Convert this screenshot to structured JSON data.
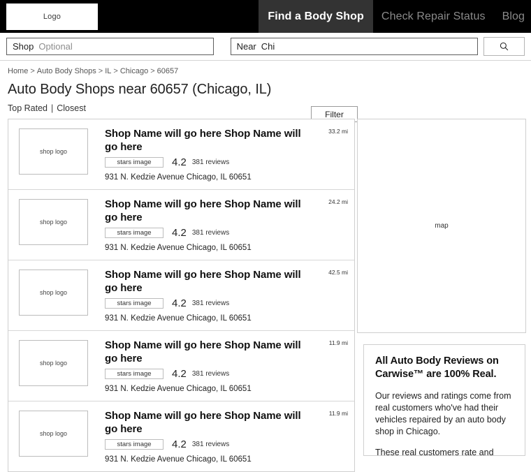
{
  "header": {
    "logo_label": "Logo",
    "nav_items": [
      {
        "label": "Find a Body Shop",
        "active": true
      },
      {
        "label": "Check Repair Status",
        "active": false
      },
      {
        "label": "Blog",
        "active": false
      }
    ]
  },
  "search": {
    "shop_label": "Shop",
    "shop_placeholder": "Optional",
    "shop_value": "",
    "near_label": "Near",
    "near_value": "Chi",
    "near_placeholder": "",
    "search_icon": "search-icon"
  },
  "breadcrumb": {
    "separator": ">",
    "items": [
      "Home",
      "Auto Body Shops",
      "IL",
      "Chicago",
      "60657"
    ]
  },
  "page": {
    "title": "Auto Body Shops near 60657 (Chicago, IL)",
    "sort_top_rated": "Top Rated",
    "sort_separator": "|",
    "sort_closest": "Closest",
    "filter_label": "Filter"
  },
  "map": {
    "label": "map"
  },
  "shops": [
    {
      "logo_label": "shop logo",
      "name": "Shop Name will go here Shop Name will go here",
      "stars_label": "stars image",
      "rating": "4.2",
      "reviews": "381 reviews",
      "address": "931 N. Kedzie Avenue Chicago, IL 60651",
      "distance": "33.2 mi"
    },
    {
      "logo_label": "shop logo",
      "name": "Shop Name will go here Shop Name will go here",
      "stars_label": "stars image",
      "rating": "4.2",
      "reviews": "381 reviews",
      "address": "931 N. Kedzie Avenue Chicago, IL 60651",
      "distance": "24.2 mi"
    },
    {
      "logo_label": "shop logo",
      "name": "Shop Name will go here Shop Name will go here",
      "stars_label": "stars image",
      "rating": "4.2",
      "reviews": "381 reviews",
      "address": "931 N. Kedzie Avenue Chicago, IL 60651",
      "distance": "42.5 mi"
    },
    {
      "logo_label": "shop logo",
      "name": "Shop Name will go here Shop Name will go here",
      "stars_label": "stars image",
      "rating": "4.2",
      "reviews": "381 reviews",
      "address": "931 N. Kedzie Avenue Chicago, IL 60651",
      "distance": "11.9 mi"
    },
    {
      "logo_label": "shop logo",
      "name": "Shop Name will go here Shop Name will go here",
      "stars_label": "stars image",
      "rating": "4.2",
      "reviews": "381 reviews",
      "address": "931 N. Kedzie Avenue Chicago, IL 60651",
      "distance": "11.9 mi"
    }
  ],
  "reviews_panel": {
    "title": "All Auto Body Reviews on Carwise™ are 100% Real.",
    "paragraph1": "Our reviews and ratings come from real customers who've had their vehicles repaired by an auto body shop in Chicago.",
    "paragraph2": "These real customers rate and review an auto body shop based on"
  },
  "colors": {
    "nav_background": "#000000",
    "nav_active_background": "#333333",
    "nav_active_text": "#ffffff",
    "nav_inactive_text": "#8a8a8a",
    "panel_border": "#cfcfcf",
    "input_border": "#5e5e5e",
    "text": "#222222"
  }
}
